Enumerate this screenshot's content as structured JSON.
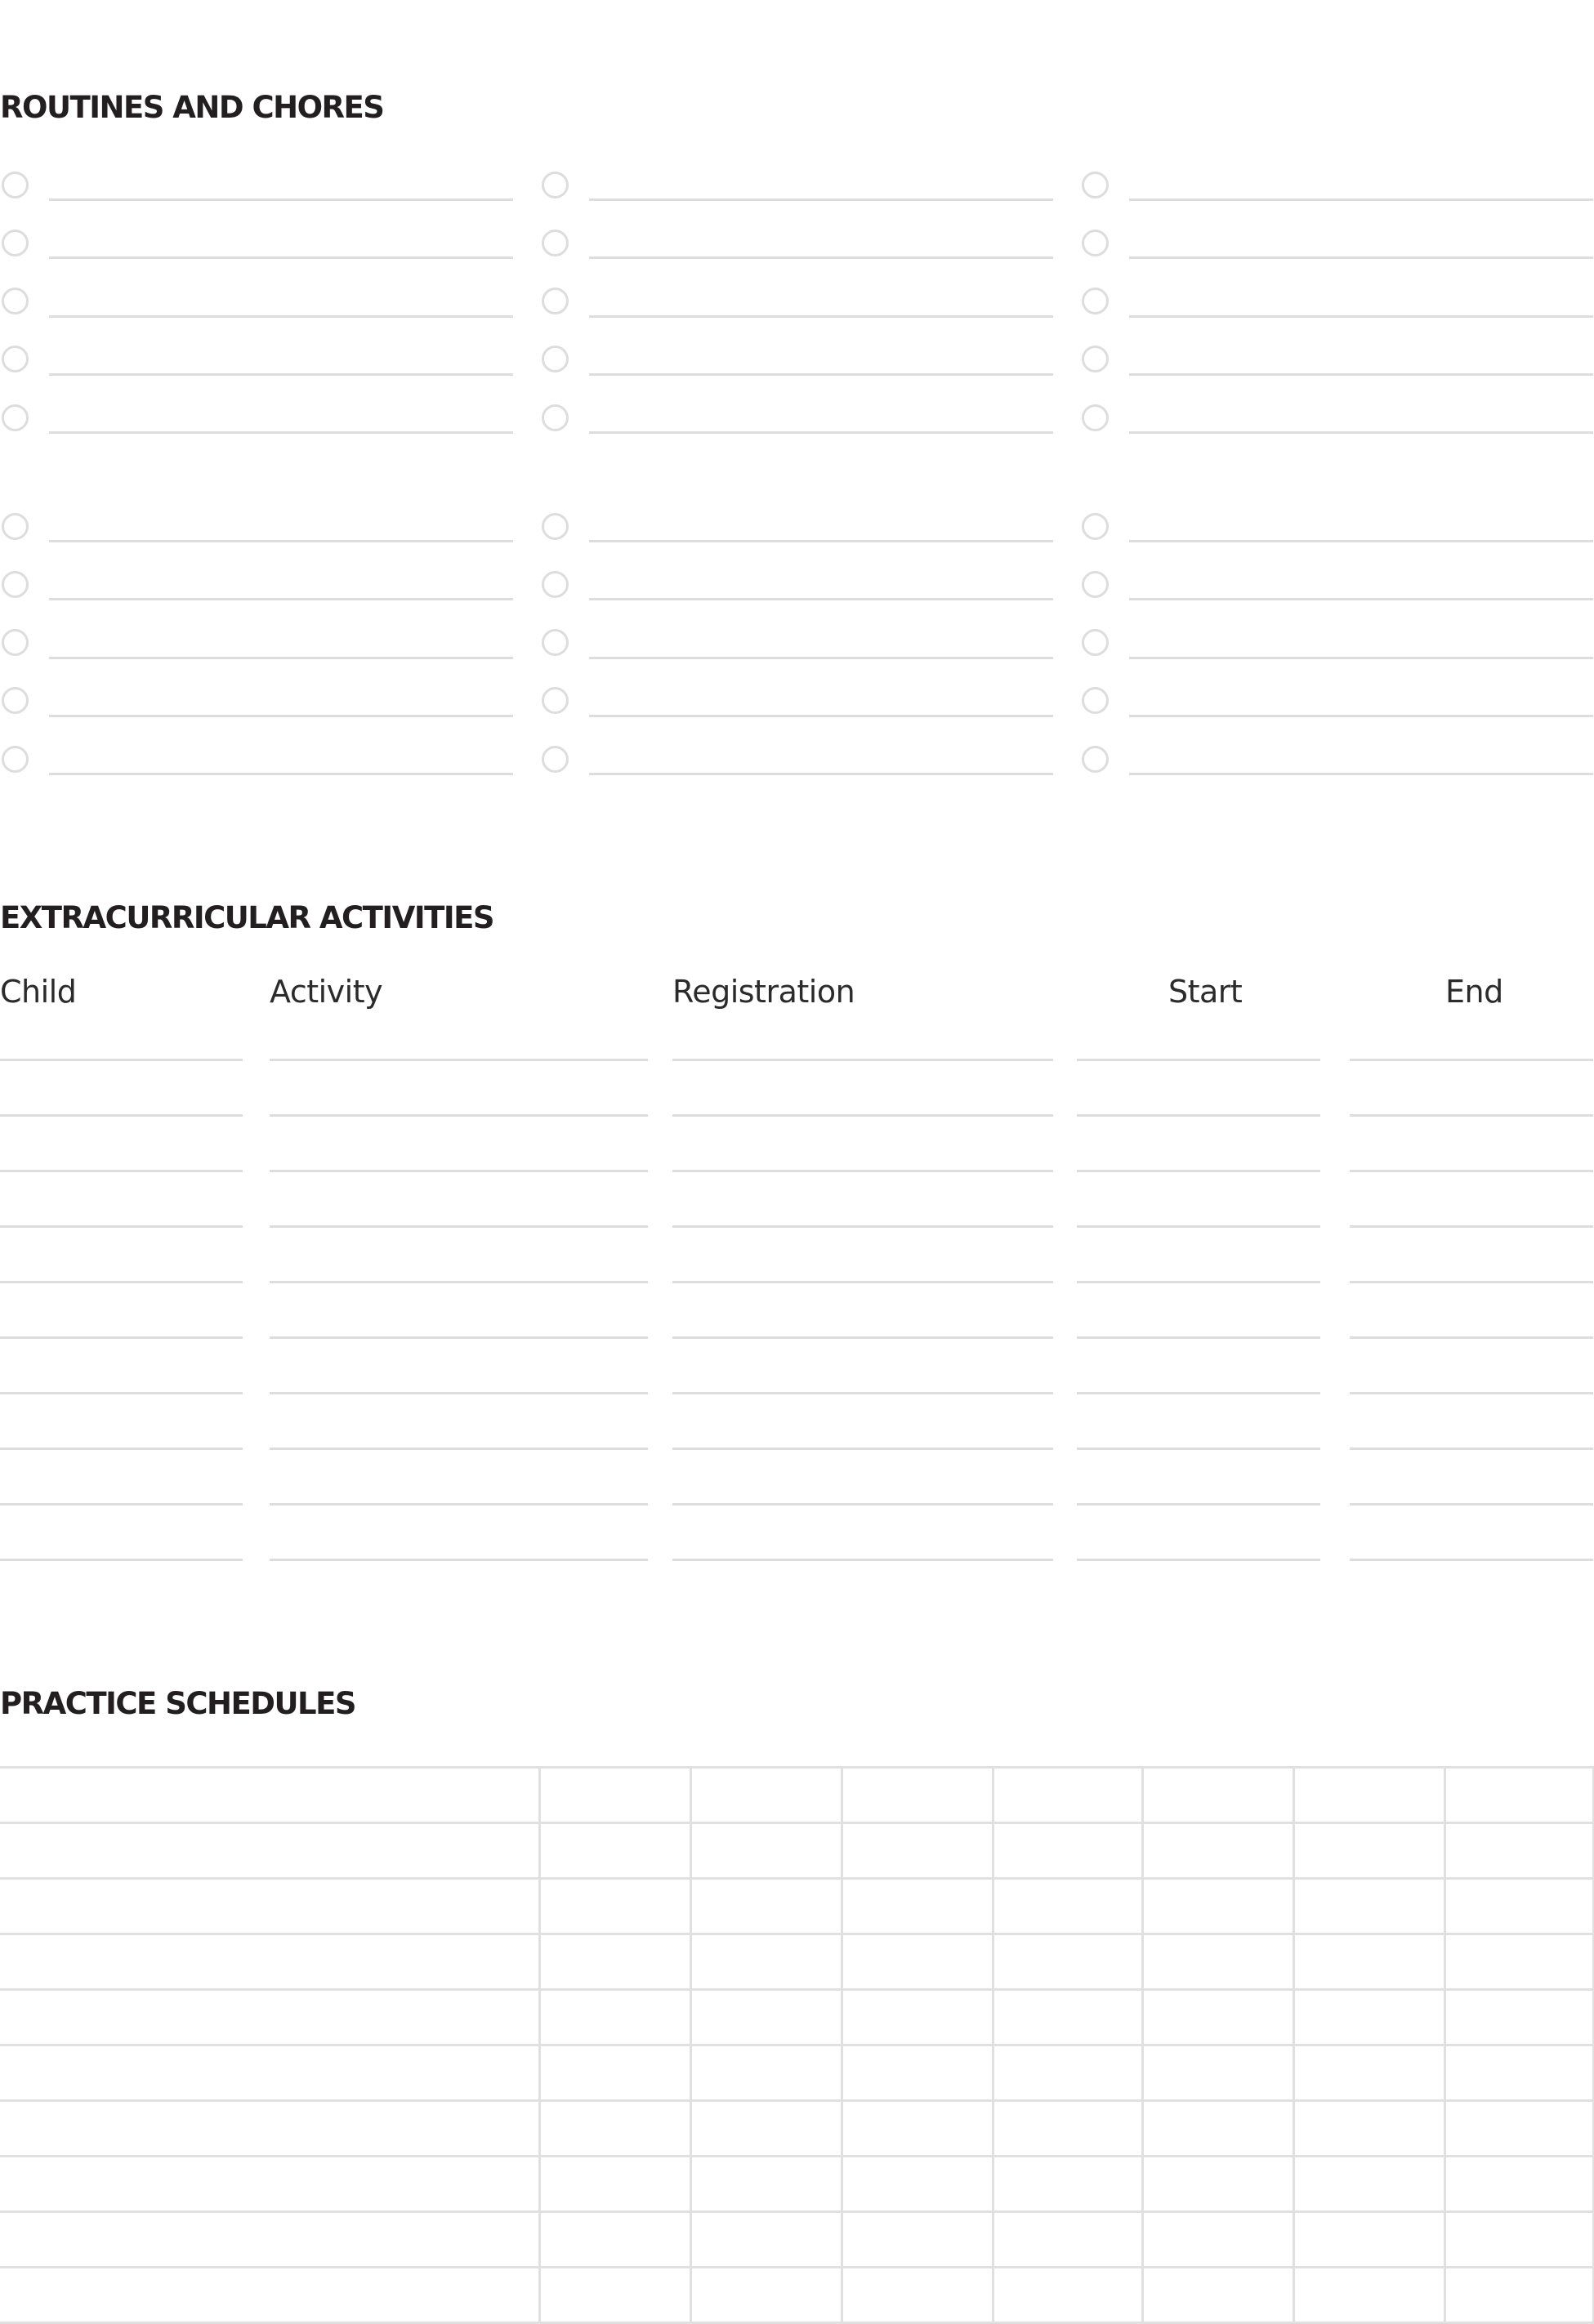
{
  "routines": {
    "title": "ROUTINES AND CHORES",
    "columns": 3,
    "groups": [
      5,
      5
    ]
  },
  "extracurricular": {
    "title": "EXTRACURRICULAR ACTIVITIES",
    "headers": [
      "Child",
      "Activity",
      "Registration",
      "Start",
      "End"
    ],
    "row_count": 10
  },
  "practice": {
    "title": "PRACTICE SCHEDULES",
    "columns": 8,
    "row_count": 10
  }
}
